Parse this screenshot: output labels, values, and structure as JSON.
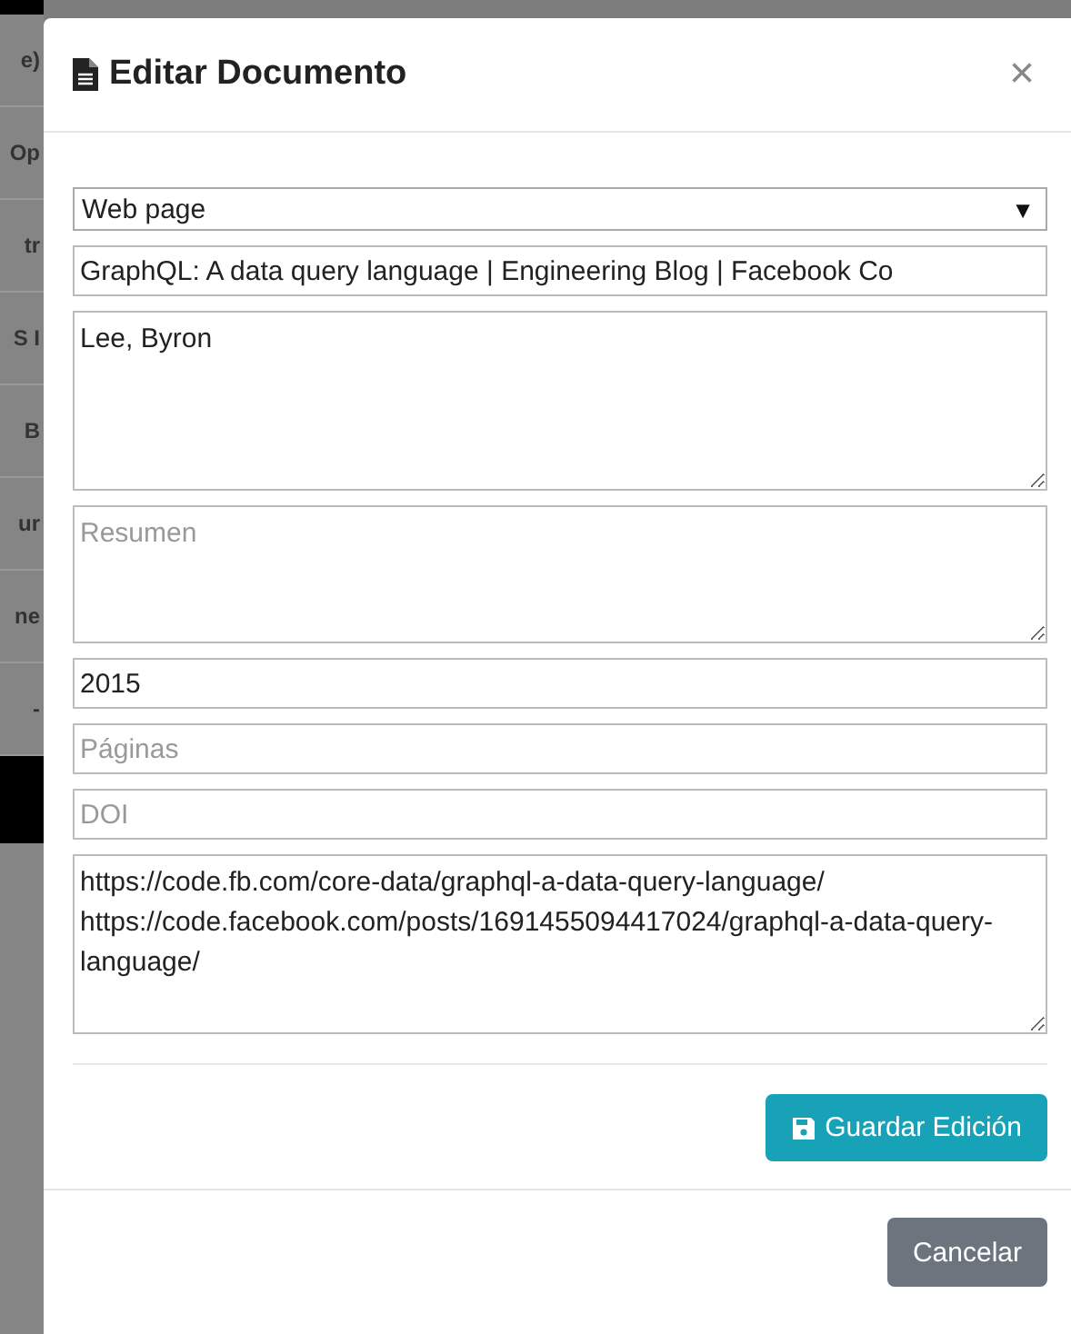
{
  "background_page": {
    "fragments": [
      "e)",
      "Op",
      "tr",
      "S I",
      "B",
      "ur",
      "ne",
      "-"
    ]
  },
  "modal": {
    "title": "Editar Documento",
    "close": "×",
    "fields": [
      {
        "kind": "select",
        "value": "Web page",
        "caret": "▼"
      },
      {
        "kind": "input",
        "value": "GraphQL: A data query language | Engineering Blog | Facebook Co"
      },
      {
        "kind": "textarea",
        "value": "Lee, Byron"
      },
      {
        "kind": "short-textarea",
        "placeholder": "Resumen"
      },
      {
        "kind": "input",
        "value": "2015"
      },
      {
        "kind": "input",
        "placeholder": "Páginas"
      },
      {
        "kind": "input",
        "placeholder": "DOI"
      },
      {
        "kind": "textarea",
        "value": "https://code.fb.com/core-data/graphql-a-data-query-language/ https://code.facebook.com/posts/1691455094417024/graphql-a-data-query-language/"
      }
    ],
    "save_button": "Guardar Edición",
    "cancel_button": "Cancelar"
  }
}
